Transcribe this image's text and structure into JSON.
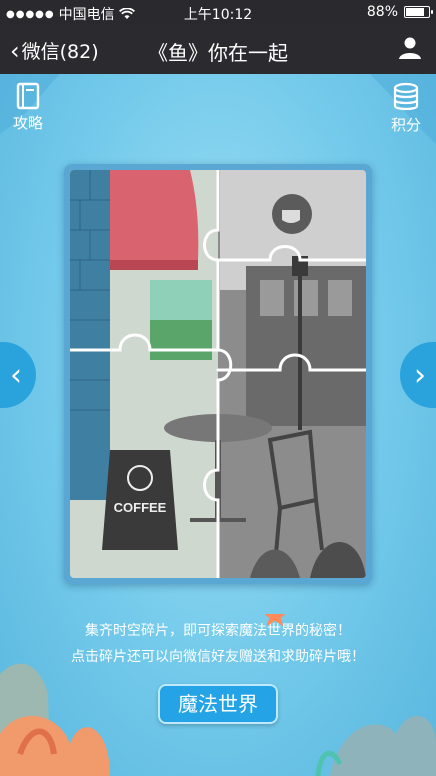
{
  "status_bar": {
    "carrier": "中国电信",
    "time": "上午10:12",
    "battery_percent": "88%",
    "battery_level": 0.88
  },
  "nav": {
    "back_label": "微信(82)",
    "title": "《鱼》你在一起"
  },
  "game": {
    "guide_label": "攻略",
    "points_label": "积分",
    "caption_line1": "集齐时空碎片，即可探索魔法世界的秘密！",
    "caption_line2": "点击碎片还可以向微信好友赠送和求助碎片哦！",
    "magic_button_label": "魔法世界",
    "puzzle": {
      "sign_text": "COFFEE"
    }
  },
  "colors": {
    "nav_bg": "#2b2b2f",
    "accent": "#24a4e6",
    "awning": "#d9636e"
  }
}
